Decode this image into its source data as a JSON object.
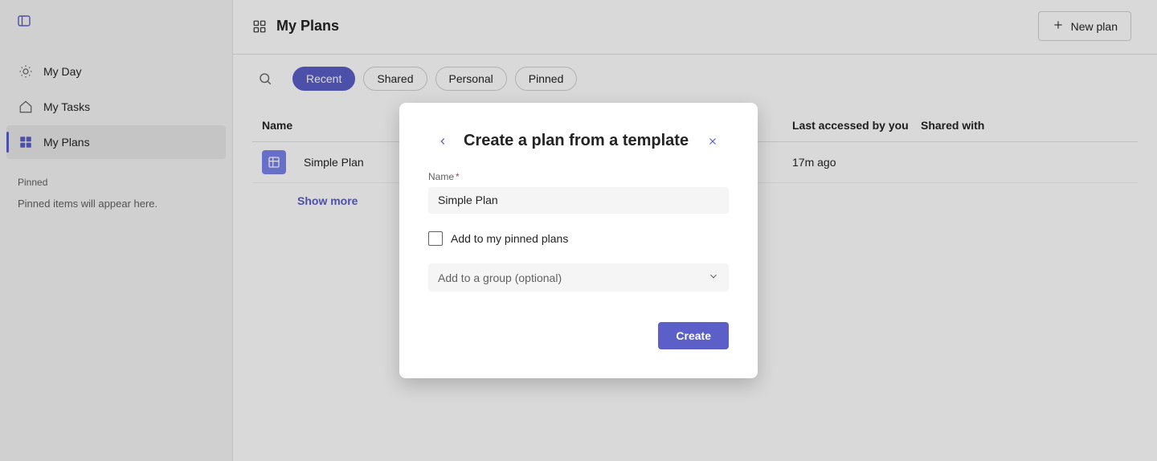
{
  "sidebar": {
    "items": [
      {
        "label": "My Day"
      },
      {
        "label": "My Tasks"
      },
      {
        "label": "My Plans"
      }
    ],
    "pinned_label": "Pinned",
    "pinned_empty": "Pinned items will appear here."
  },
  "header": {
    "title": "My Plans",
    "new_plan_label": "New plan"
  },
  "filters": {
    "recent": "Recent",
    "shared": "Shared",
    "personal": "Personal",
    "pinned": "Pinned"
  },
  "table": {
    "col_name": "Name",
    "col_accessed": "Last accessed by you",
    "col_shared": "Shared with",
    "rows": [
      {
        "name": "Simple Plan",
        "accessed": "17m ago",
        "shared": ""
      }
    ],
    "show_more": "Show more"
  },
  "modal": {
    "title": "Create a plan from a template",
    "name_label": "Name",
    "name_value": "Simple Plan",
    "pin_label": "Add to my pinned plans",
    "group_placeholder": "Add to a group (optional)",
    "create_label": "Create"
  }
}
